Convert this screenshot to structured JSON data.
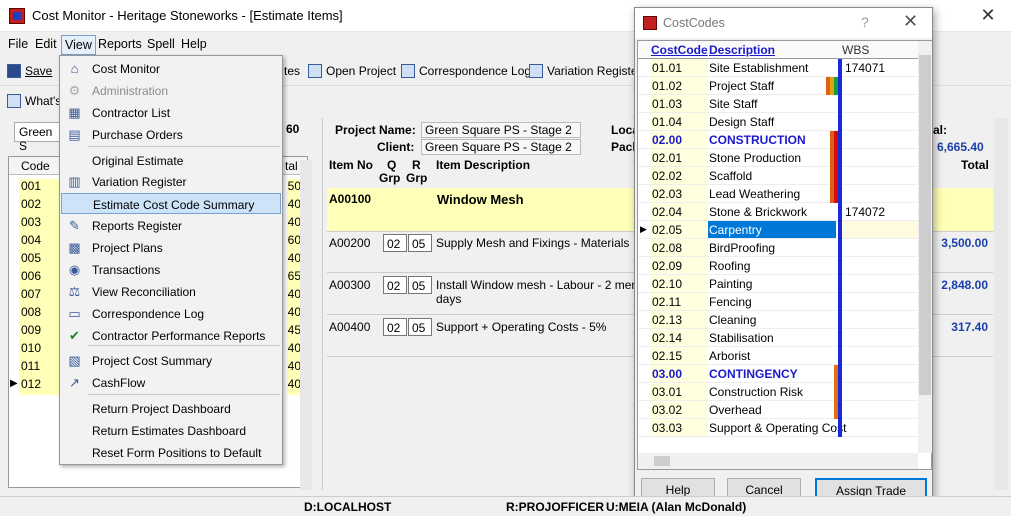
{
  "window": {
    "title": "Cost Monitor - Heritage Stoneworks - [Estimate Items]"
  },
  "menubar": {
    "items": [
      "File",
      "Edit",
      "View",
      "Reports",
      "Spell",
      "Help"
    ]
  },
  "toolbar": {
    "save": "Save",
    "whats": "What's",
    "tes": "tes",
    "open_project": "Open Project",
    "correspondence_log": "Correspondence Log",
    "variation_register": "Variation Register"
  },
  "left": {
    "combo_value": "Green S",
    "header_code": "Code",
    "header_total": "tal",
    "amount_stub": "60",
    "rows": [
      {
        "code": "001",
        "v": "50"
      },
      {
        "code": "002",
        "v": "40"
      },
      {
        "code": "003",
        "v": "40"
      },
      {
        "code": "004",
        "v": "60"
      },
      {
        "code": "005",
        "v": "40"
      },
      {
        "code": "006",
        "v": "65"
      },
      {
        "code": "007",
        "v": "40"
      },
      {
        "code": "008",
        "v": "40"
      },
      {
        "code": "009",
        "v": "45"
      },
      {
        "code": "010",
        "v": "40"
      },
      {
        "code": "011",
        "v": "40"
      },
      {
        "code": "012",
        "v": "40"
      }
    ]
  },
  "main": {
    "project_name_label": "Project Name:",
    "project_name": "Green Square PS - Stage 2",
    "client_label": "Client:",
    "client": "Green Square PS - Stage 2",
    "loc_label": "Loca",
    "pack_label": "Pack",
    "total_label": "tal:",
    "total_value": "6,665.40",
    "col_item_no": "Item No",
    "col_q": "Q",
    "col_grp_q": "Grp",
    "col_r": "R",
    "col_grp_r": "Grp",
    "col_desc": "Item Description",
    "col_total": "Total",
    "section_code": "A00100",
    "section_desc": "Window Mesh",
    "items": [
      {
        "no": "A00200",
        "q": "02",
        "r": "05",
        "desc": "Supply Mesh and Fixings - Materials",
        "desc2": "",
        "amount": "3,500.00"
      },
      {
        "no": "A00300",
        "q": "02",
        "r": "05",
        "desc": "Install Window mesh - Labour - 2 men x 2",
        "desc2": "days",
        "amount": "2,848.00"
      },
      {
        "no": "A00400",
        "q": "02",
        "r": "05",
        "desc": "Support + Operating Costs - 5%",
        "desc2": "",
        "amount": "317.40"
      }
    ]
  },
  "view_menu": {
    "items": [
      {
        "label": "Cost Monitor",
        "icon": "cost-monitor-icon",
        "disabled": false
      },
      {
        "label": "Administration",
        "icon": "administration-icon",
        "disabled": true
      },
      {
        "label": "Contractor List",
        "icon": "contractor-list-icon",
        "disabled": false
      },
      {
        "label": "Purchase Orders",
        "icon": "purchase-orders-icon",
        "disabled": false
      },
      {
        "label": "Original Estimate",
        "icon": "",
        "disabled": false
      },
      {
        "label": "Variation Register",
        "icon": "variation-register-icon",
        "disabled": false
      },
      {
        "label": "Estimate Cost Code Summary",
        "icon": "",
        "disabled": false
      },
      {
        "label": "Reports Register",
        "icon": "reports-register-icon",
        "disabled": false
      },
      {
        "label": "Project Plans",
        "icon": "project-plans-icon",
        "disabled": false
      },
      {
        "label": "Transactions",
        "icon": "transactions-icon",
        "disabled": false
      },
      {
        "label": "View Reconciliation",
        "icon": "reconciliation-icon",
        "disabled": false
      },
      {
        "label": "Correspondence Log",
        "icon": "correspondence-log-icon",
        "disabled": false
      },
      {
        "label": "Contractor Performance Reports",
        "icon": "checkmark-icon",
        "disabled": false
      },
      {
        "label": "Project Cost Summary",
        "icon": "project-cost-summary-icon",
        "disabled": false
      },
      {
        "label": "CashFlow",
        "icon": "cashflow-icon",
        "disabled": false
      },
      {
        "label": "Return Project Dashboard",
        "icon": "",
        "disabled": false
      },
      {
        "label": "Return Estimates Dashboard",
        "icon": "",
        "disabled": false
      },
      {
        "label": "Reset Form Positions to Default",
        "icon": "",
        "disabled": false
      }
    ],
    "highlighted": "Estimate Cost Code Summary"
  },
  "costcodes": {
    "title": "CostCodes",
    "help_glyph": "?",
    "close_glyph": "✕",
    "headers": {
      "code": "CostCode",
      "desc": "Description",
      "wbs": "WBS"
    },
    "rows": [
      {
        "code": "01.01",
        "desc": "Site Establishment",
        "wbs": "174071",
        "hdr": false
      },
      {
        "code": "01.02",
        "desc": "Project Staff",
        "wbs": "",
        "hdr": false
      },
      {
        "code": "01.03",
        "desc": "Site Staff",
        "wbs": "",
        "hdr": false
      },
      {
        "code": "01.04",
        "desc": "Design Staff",
        "wbs": "",
        "hdr": false
      },
      {
        "code": "02.00",
        "desc": "CONSTRUCTION",
        "wbs": "",
        "hdr": true
      },
      {
        "code": "02.01",
        "desc": "Stone Production",
        "wbs": "",
        "hdr": false
      },
      {
        "code": "02.02",
        "desc": "Scaffold",
        "wbs": "",
        "hdr": false
      },
      {
        "code": "02.03",
        "desc": "Lead Weathering",
        "wbs": "",
        "hdr": false
      },
      {
        "code": "02.04",
        "desc": "Stone & Brickwork",
        "wbs": "174072",
        "hdr": false
      },
      {
        "code": "02.05",
        "desc": "Carpentry",
        "wbs": "",
        "hdr": false
      },
      {
        "code": "02.08",
        "desc": "BirdProofing",
        "wbs": "",
        "hdr": false
      },
      {
        "code": "02.09",
        "desc": "Roofing",
        "wbs": "",
        "hdr": false
      },
      {
        "code": "02.10",
        "desc": "Painting",
        "wbs": "",
        "hdr": false
      },
      {
        "code": "02.11",
        "desc": "Fencing",
        "wbs": "",
        "hdr": false
      },
      {
        "code": "02.13",
        "desc": "Cleaning",
        "wbs": "",
        "hdr": false
      },
      {
        "code": "02.14",
        "desc": "Stabilisation",
        "wbs": "",
        "hdr": false
      },
      {
        "code": "02.15",
        "desc": "Arborist",
        "wbs": "",
        "hdr": false
      },
      {
        "code": "03.00",
        "desc": "CONTINGENCY",
        "wbs": "",
        "hdr": true
      },
      {
        "code": "03.01",
        "desc": "Construction Risk",
        "wbs": "",
        "hdr": false
      },
      {
        "code": "03.02",
        "desc": "Overhead",
        "wbs": "",
        "hdr": false
      },
      {
        "code": "03.03",
        "desc": "Support & Operating Cost",
        "wbs": "",
        "hdr": false
      }
    ],
    "selected": "02.05",
    "buttons": {
      "help": "Help",
      "cancel": "Cancel",
      "assign": "Assign Trade"
    }
  },
  "status": {
    "d": "D:LOCALHOST",
    "r": "R:PROJOFFICER",
    "u": "U:MEIA (Alan McDonald)"
  }
}
